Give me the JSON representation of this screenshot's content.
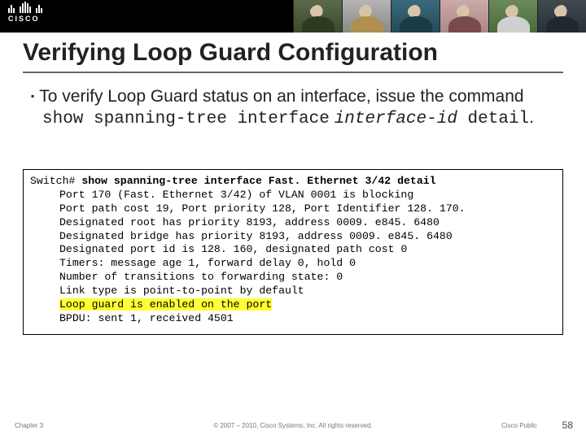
{
  "brand": {
    "name": "CISCO"
  },
  "title": "Verifying Loop Guard Configuration",
  "bullet": {
    "pre": "To verify Loop Guard status on an interface, issue the command ",
    "cmd_a": "show spanning-tree interface",
    "cmd_b": "interface-id",
    "cmd_c": " detail",
    "post": "."
  },
  "cli": {
    "prompt": "Switch#",
    "command": "show spanning-tree interface Fast. Ethernet 3/42 detail",
    "lines": [
      "Port 170 (Fast. Ethernet 3/42) of VLAN 0001 is blocking",
      "Port path cost 19, Port priority 128, Port Identifier 128. 170.",
      "Designated root has priority 8193, address 0009. e845. 6480",
      "Designated bridge has priority 8193, address 0009. e845. 6480",
      "Designated port id is 128. 160, designated path cost 0",
      "Timers: message age 1, forward delay 0, hold 0",
      "Number of transitions to forwarding state: 0",
      "Link type is point-to-point by default",
      "Loop guard is enabled on the port",
      "BPDU: sent 1, received 4501"
    ],
    "highlight_index": 8
  },
  "footer": {
    "chapter": "Chapter 3",
    "copyright": "© 2007 – 2010, Cisco Systems, Inc. All rights reserved.",
    "visibility": "Cisco Public",
    "page": "58"
  }
}
